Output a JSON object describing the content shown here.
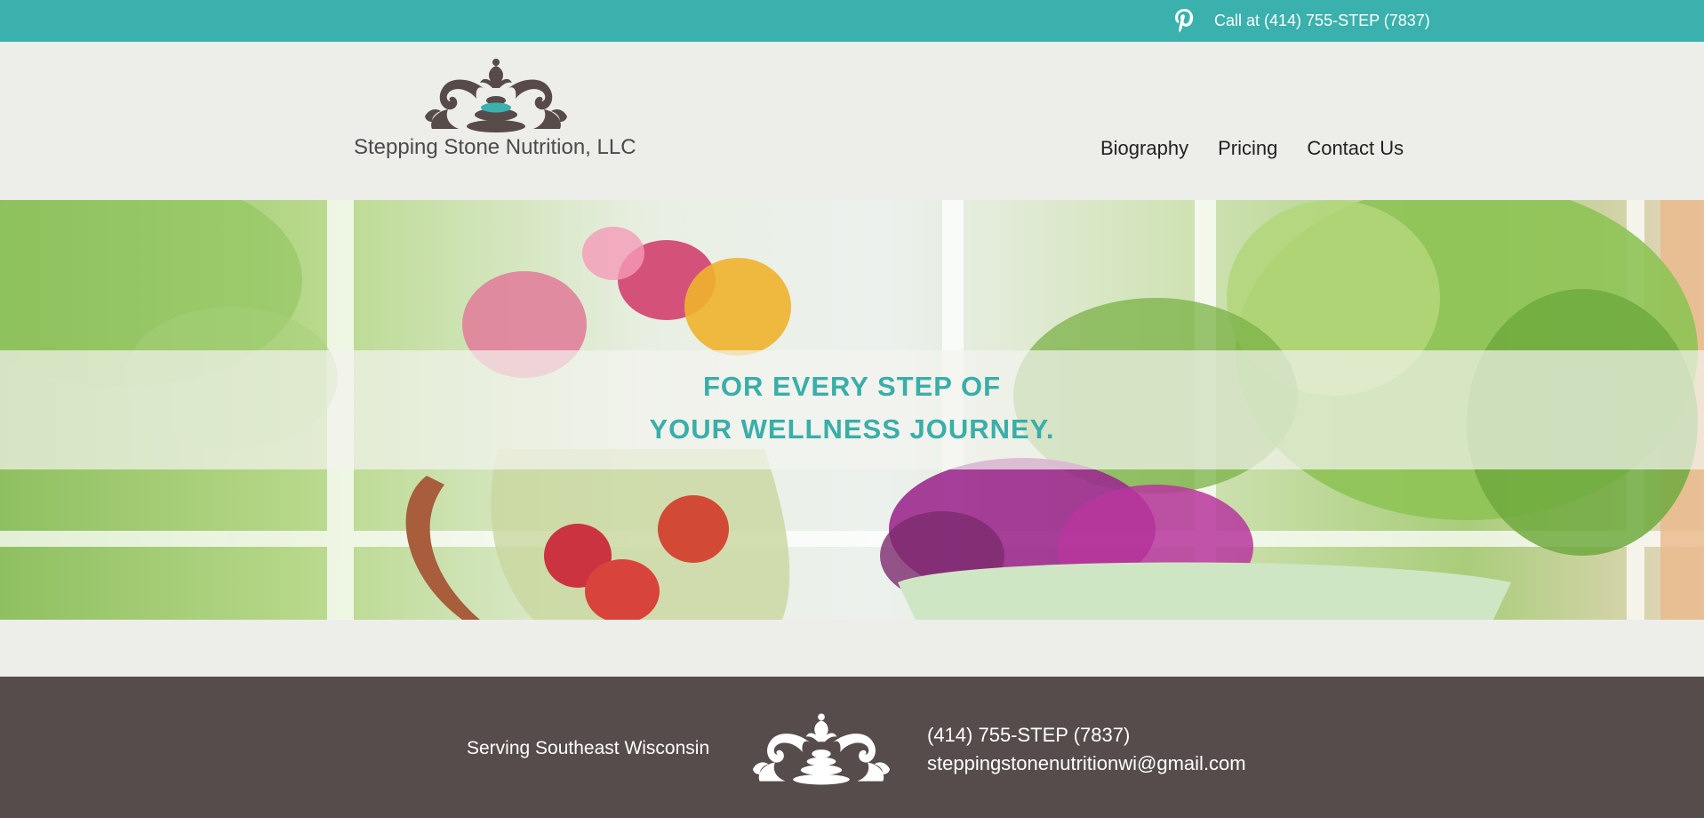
{
  "topbar": {
    "social_icon": "pinterest-icon",
    "call_text": "Call at (414) 755-STEP (7837)"
  },
  "header": {
    "logo_icon": "stacked-stones-ornament-icon",
    "brand_name": "Stepping Stone Nutrition, LLC",
    "nav": [
      {
        "label": "Biography"
      },
      {
        "label": "Pricing"
      },
      {
        "label": "Contact Us"
      }
    ]
  },
  "hero": {
    "tagline_line1": "FOR EVERY STEP OF",
    "tagline_line2": "YOUR WELLNESS JOURNEY."
  },
  "footer": {
    "serving": "Serving Southeast Wisconsin",
    "logo_icon": "stacked-stones-ornament-icon",
    "phone": "(414) 755-STEP (7837)",
    "email": "steppingstonenutritionwi@gmail.com"
  },
  "colors": {
    "accent_teal": "#3ab1ac",
    "footer_brown": "#564c4b",
    "logo_brown": "#574b49",
    "page_bg": "#ededea"
  }
}
